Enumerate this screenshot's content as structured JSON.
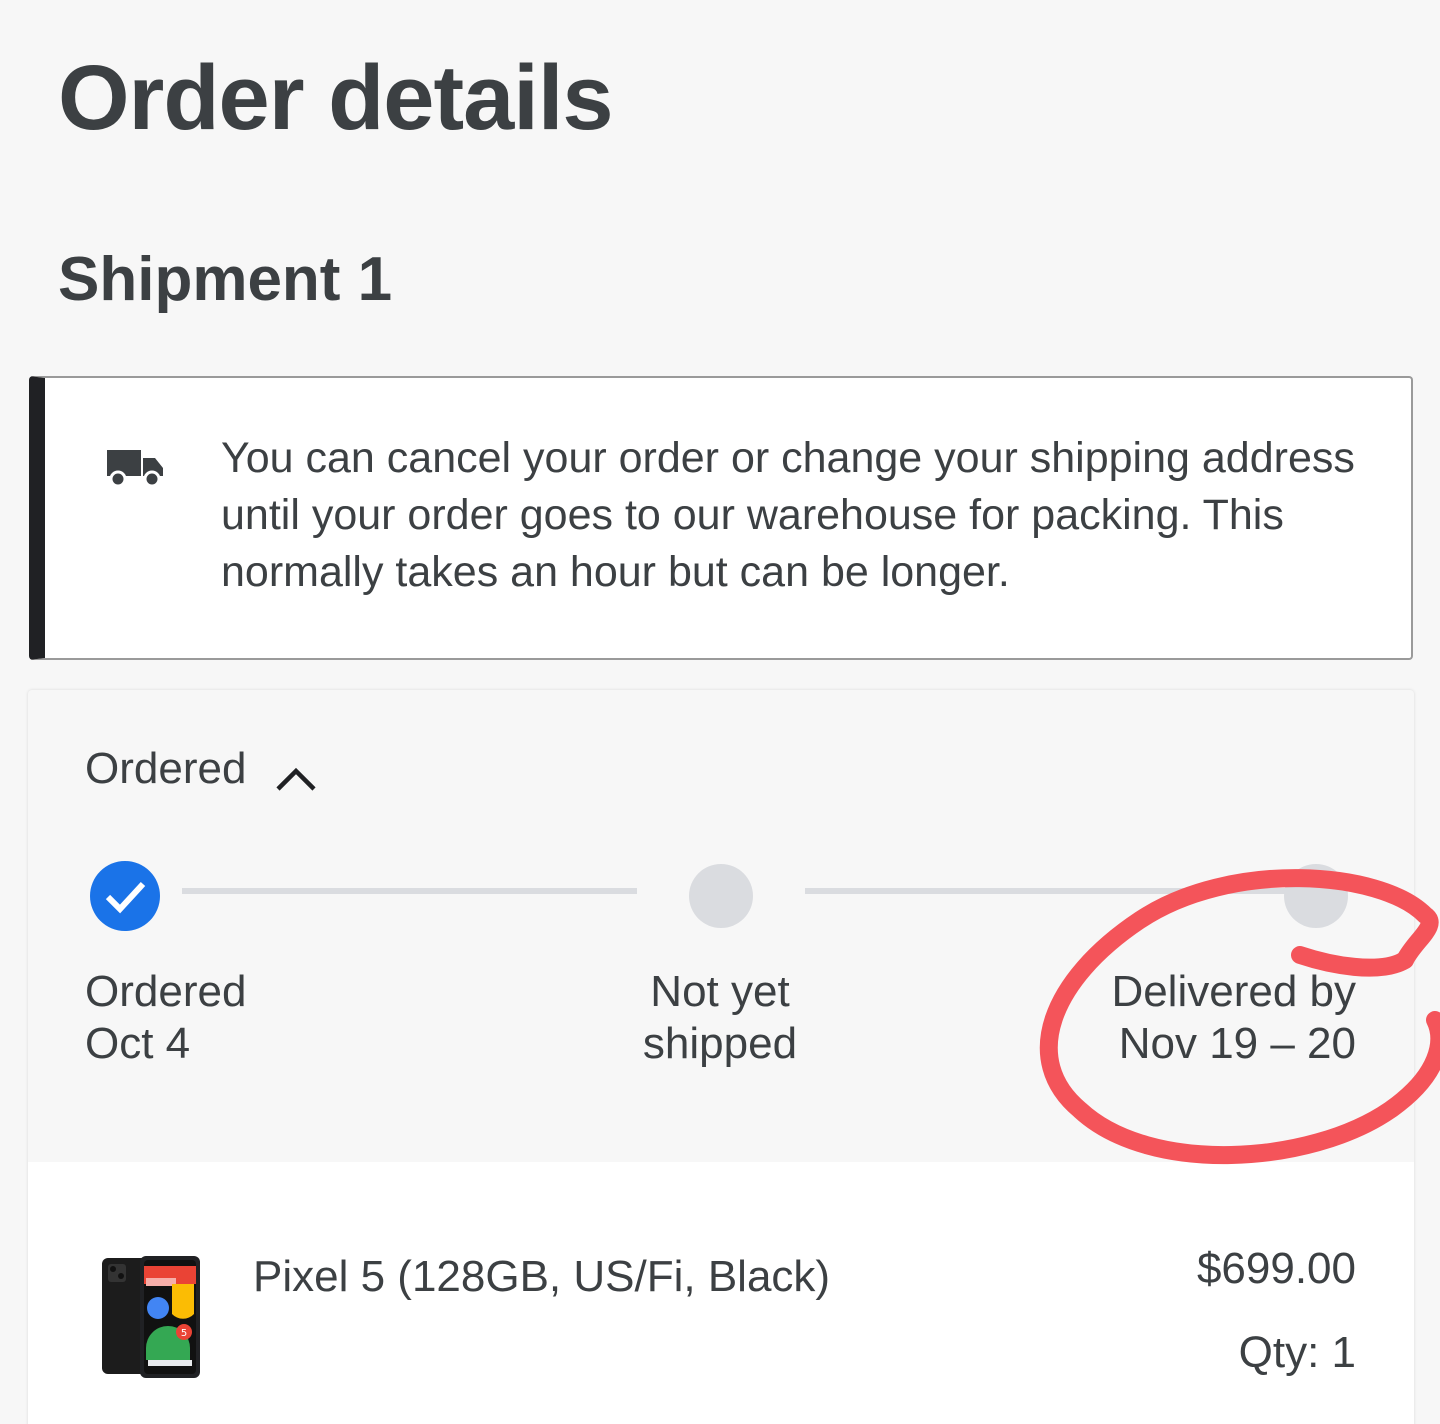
{
  "header": {
    "title": "Order details"
  },
  "shipment": {
    "title": "Shipment 1",
    "notice": {
      "icon": "truck-icon",
      "text": "You can cancel your order or change your shipping address until your order goes to our warehouse for packing. This normally takes an hour but can be longer."
    },
    "status": {
      "label": "Ordered",
      "toggle_icon": "chevron-up-icon",
      "steps": [
        {
          "line1": "Ordered",
          "line2": "Oct 4",
          "state": "complete"
        },
        {
          "line1": "Not yet",
          "line2": "shipped",
          "state": "pending"
        },
        {
          "line1": "Delivered by",
          "line2": "Nov 19 – 20",
          "state": "pending"
        }
      ]
    },
    "item": {
      "image": "pixel-5-phone-image",
      "name": "Pixel 5 (128GB, US/Fi, Black)",
      "price": "$699.00",
      "qty": "Qty: 1"
    }
  },
  "colors": {
    "accent": "#1a73e8",
    "annotation": "#f4545a",
    "pending": "#dadce0"
  }
}
